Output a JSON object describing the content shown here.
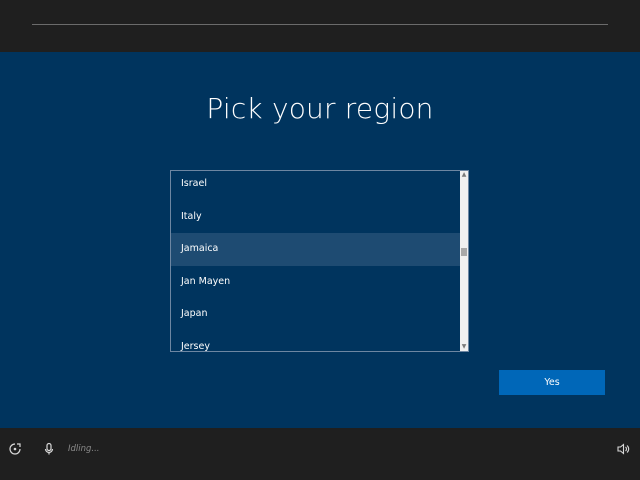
{
  "page": {
    "title": "Pick your region"
  },
  "region_list": {
    "items": [
      {
        "label": "Israel",
        "selected": false
      },
      {
        "label": "Italy",
        "selected": false
      },
      {
        "label": "Jamaica",
        "selected": true
      },
      {
        "label": "Jan Mayen",
        "selected": false
      },
      {
        "label": "Japan",
        "selected": false
      },
      {
        "label": "Jersey",
        "selected": false
      }
    ],
    "scroll_icons": {
      "up": "chevron-up-icon",
      "down": "chevron-down-icon"
    }
  },
  "actions": {
    "yes_label": "Yes"
  },
  "footer": {
    "status": "Idling...",
    "icons": [
      "accessibility-icon",
      "microphone-icon",
      "volume-icon"
    ]
  },
  "colors": {
    "background": "#00345e",
    "bar": "#1f1f1f",
    "selected_row": "#1e4b72",
    "button": "#0067b8",
    "list_border": "#6d86a2"
  }
}
